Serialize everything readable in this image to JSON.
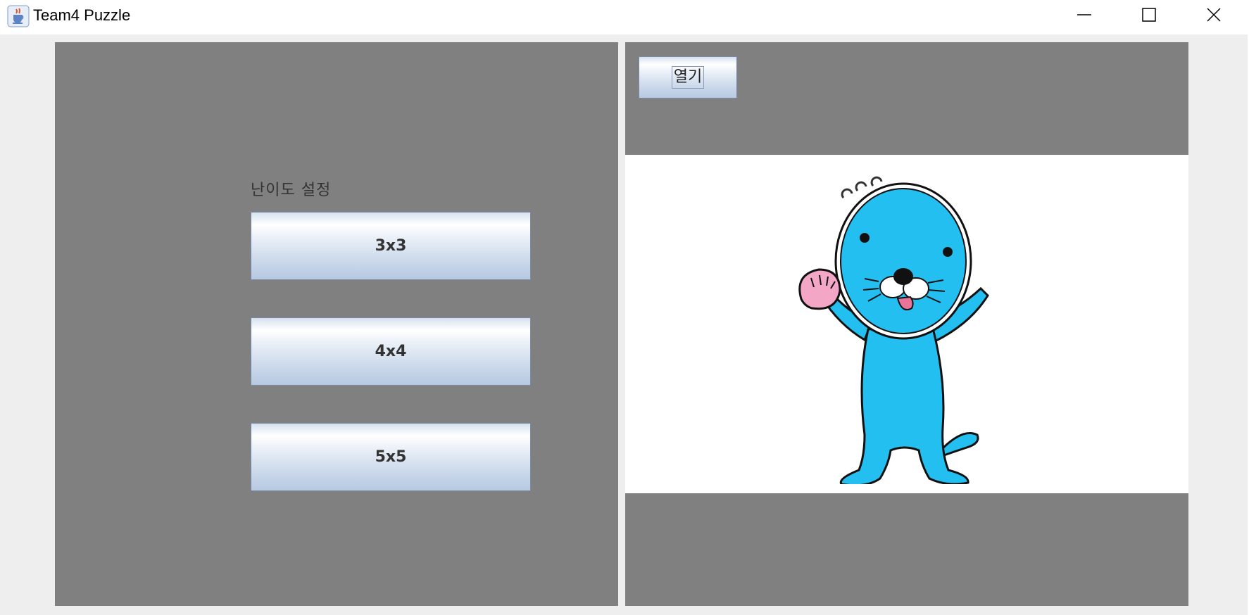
{
  "window": {
    "title": "Team4 Puzzle",
    "icon": "java-cup-icon",
    "controls": [
      "minimize-icon",
      "maximize-icon",
      "close-icon"
    ]
  },
  "left_panel": {
    "label": "난이도 설정",
    "buttons": [
      {
        "label": "3x3"
      },
      {
        "label": "4x4"
      },
      {
        "label": "5x5"
      }
    ]
  },
  "right_panel": {
    "open_button": "열기",
    "preview": "blue-otter-mascot-image"
  },
  "colors": {
    "panel_bg": "#808080",
    "window_bg": "#eeeeee",
    "mascot_blue": "#22bff0",
    "button_text": "#333333"
  }
}
